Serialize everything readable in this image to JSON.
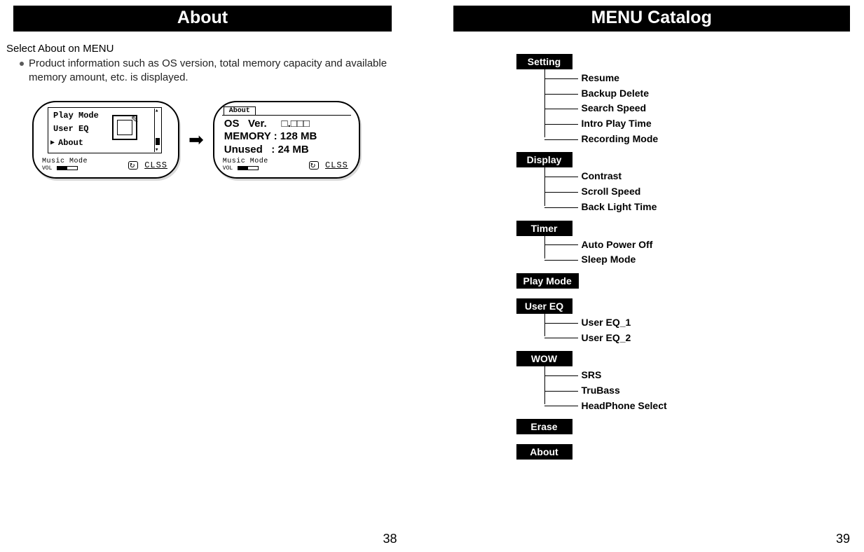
{
  "left": {
    "banner": "About",
    "intro": "Select About on MENU",
    "bullet": "Product information such as OS version, total memory capacity and available memory amount, etc. is displayed.",
    "lcd1": {
      "item1": "Play Mode",
      "item2": "User EQ",
      "item3": "About",
      "status_mode": "Music Mode",
      "vol_label": "VOL",
      "clss": "CLSS"
    },
    "lcd2": {
      "tab": "About",
      "row1": "OS   Ver.     □.□□□",
      "row2": "MEMORY : 128 MB",
      "row3": "Unused   : 24 MB",
      "status_mode": "Music Mode",
      "vol_label": "VOL",
      "clss": "CLSS"
    },
    "page_number": "38"
  },
  "right": {
    "banner": "MENU Catalog",
    "groups": {
      "setting": {
        "label": "Setting",
        "items": [
          "Resume",
          "Backup Delete",
          "Search Speed",
          "Intro Play Time",
          "Recording Mode"
        ]
      },
      "display": {
        "label": "Display",
        "items": [
          "Contrast",
          "Scroll Speed",
          "Back Light Time"
        ]
      },
      "timer": {
        "label": "Timer",
        "items": [
          "Auto  Power Off",
          "Sleep Mode"
        ]
      },
      "playmode": {
        "label": "Play Mode"
      },
      "usereq": {
        "label": "User EQ",
        "items": [
          "User EQ_1",
          "User EQ_2"
        ]
      },
      "wow": {
        "label": "WOW",
        "items": [
          "SRS",
          "TruBass",
          "HeadPhone Select"
        ]
      },
      "erase": {
        "label": "Erase"
      },
      "about": {
        "label": "About"
      }
    },
    "page_number": "39"
  }
}
